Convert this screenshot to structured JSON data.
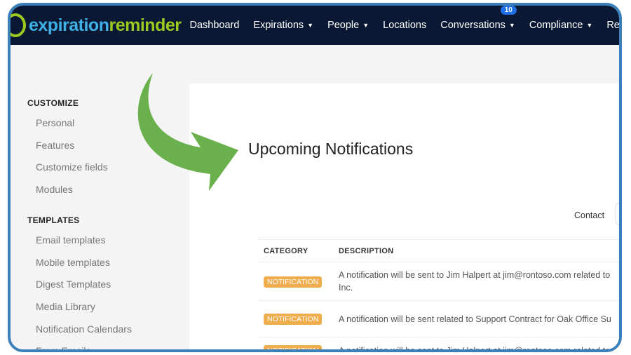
{
  "brand": {
    "part1": "expiration",
    "part2": "reminder"
  },
  "nav": [
    {
      "label": "Dashboard"
    },
    {
      "label": "Expirations",
      "dropdown": true
    },
    {
      "label": "People",
      "dropdown": true
    },
    {
      "label": "Locations"
    },
    {
      "label": "Conversations",
      "dropdown": true,
      "badge": "10"
    },
    {
      "label": "Compliance",
      "dropdown": true
    },
    {
      "label": "Reports"
    }
  ],
  "sidebar": {
    "customize_title": "CUSTOMIZE",
    "customize": [
      "Personal",
      "Features",
      "Customize fields",
      "Modules"
    ],
    "templates_title": "TEMPLATES",
    "templates": [
      "Email templates",
      "Mobile templates",
      "Digest Templates",
      "Media Library",
      "Notification Calendars",
      "From Emails"
    ]
  },
  "main": {
    "title": "Upcoming Notifications",
    "contact_label": "Contact",
    "columns": [
      "CATEGORY",
      "DESCRIPTION"
    ],
    "rows": [
      {
        "category": "NOTIFICATION",
        "description": "A notification will be sent to Jim Halpert at jim@rontoso.com related to",
        "description2": "Inc."
      },
      {
        "category": "NOTIFICATION",
        "description": "A notification will be sent related to Support Contract for Oak Office Su"
      },
      {
        "category": "NOTIFICATION",
        "description": "A notification will be sent to Jim Halpert at jim@rontoso.com related to"
      }
    ]
  },
  "colors": {
    "navbar": "#0b1833",
    "accent_blue": "#3eb0e6",
    "accent_green": "#9ccb1f",
    "badge": "#f0ad4e",
    "arrow": "#6ab04c",
    "frame": "#3b80b9"
  }
}
